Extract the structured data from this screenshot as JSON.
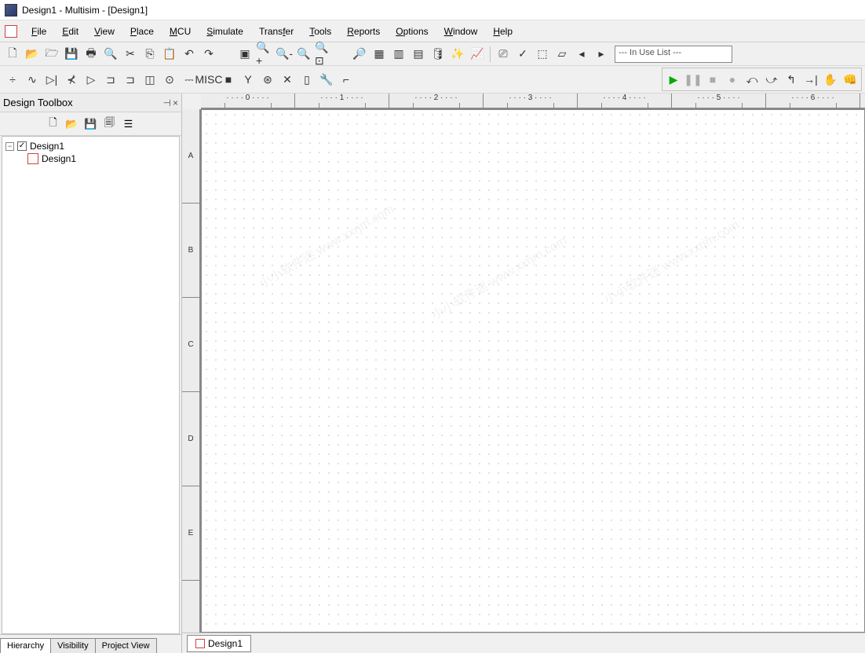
{
  "window": {
    "title": "Design1 - Multisim - [Design1]"
  },
  "menubar": {
    "items": [
      "File",
      "Edit",
      "View",
      "Place",
      "MCU",
      "Simulate",
      "Transfer",
      "Tools",
      "Reports",
      "Options",
      "Window",
      "Help"
    ],
    "underline_index": [
      0,
      0,
      0,
      0,
      0,
      0,
      5,
      0,
      0,
      0,
      0,
      0
    ]
  },
  "toolbar1": {
    "icons": [
      "new-icon",
      "open-icon",
      "open-sample-icon",
      "save-icon",
      "print-icon",
      "print-preview-icon",
      "cut-icon",
      "copy-icon",
      "paste-icon",
      "undo-icon",
      "redo-icon"
    ],
    "glyphs": [
      "🗋",
      "📂",
      "🗁",
      "💾",
      "🖶",
      "🔍",
      "✂",
      "⎘",
      "📋",
      "↶",
      "↷"
    ]
  },
  "toolbar1b": {
    "icons": [
      "full-screen-icon",
      "zoom-in-icon",
      "zoom-out-icon",
      "zoom-area-icon",
      "zoom-fit-icon"
    ],
    "glyphs": [
      "▣",
      "🔍+",
      "🔍-",
      "🔍",
      "🔍⊡"
    ]
  },
  "toolbar1c": {
    "icons": [
      "find-icon",
      "spreadsheet-icon",
      "grapher-icon",
      "postprocessor-icon",
      "db-manager-icon",
      "component-wizard-icon",
      "analyses-icon",
      "sep",
      "netlist-icon",
      "drc-icon",
      "capture-area-icon",
      "misc-icon",
      "back-annotate-icon",
      "forward-annotate-icon"
    ],
    "glyphs": [
      "🔎",
      "▦",
      "▥",
      "▤",
      "🛢",
      "✨",
      "📈",
      "",
      "⎚",
      "✓",
      "⬚",
      "▱",
      "◂",
      "▸"
    ],
    "in_use_list": "--- In Use List ---"
  },
  "toolbar2": {
    "icons": [
      "source-icon",
      "basic-icon",
      "diode-icon",
      "transistor-icon",
      "analog-icon",
      "ttl-icon",
      "cmos-icon",
      "misc-digital-icon",
      "indicator-icon",
      "power-icon",
      "misc-icon",
      "advanced-icon",
      "rf-icon",
      "electromech-icon",
      "connector-icon",
      "mcu-icon",
      "hierarchy-icon",
      "bus-icon"
    ],
    "glyphs": [
      "÷",
      "∿",
      "▷|",
      "⊀",
      "▷",
      "⊐",
      "⊐",
      "◫",
      "⊙",
      "⎓",
      "MISC",
      "■",
      "Y",
      "⊛",
      "✕",
      "▯",
      "🔧",
      "⌐"
    ]
  },
  "simulation": {
    "icons": [
      "run-icon",
      "pause-icon",
      "stop-icon",
      "record-icon",
      "step-back-icon",
      "step-into-icon",
      "step-over-icon",
      "step-out-icon",
      "hand-icon",
      "grab-icon"
    ],
    "glyphs": [
      "▶",
      "❚❚",
      "■",
      "●",
      "⤺",
      "⤻",
      "↰",
      "→|",
      "✋",
      "👊"
    ]
  },
  "sidebar": {
    "title": "Design Toolbox",
    "close_glyph": "×",
    "pin_glyph": "⊣",
    "tb_icons": [
      "new-page-icon",
      "open-icon",
      "save-icon",
      "rename-icon",
      "properties-icon"
    ],
    "tb_glyphs": [
      "🗋",
      "📂",
      "💾",
      "🗐",
      "☰"
    ],
    "tree": {
      "root": "Design1",
      "child": "Design1"
    },
    "tabs": [
      "Hierarchy",
      "Visibility",
      "Project View"
    ],
    "active_tab": 0
  },
  "ruler": {
    "h_ticks": [
      "0",
      "1",
      "2",
      "3",
      "4",
      "5",
      "6"
    ],
    "v_ticks": [
      "A",
      "B",
      "C",
      "D",
      "E"
    ]
  },
  "canvas_tabs": {
    "items": [
      "Design1"
    ]
  },
  "watermark": "小小软件迷 www.xxrjm.com"
}
